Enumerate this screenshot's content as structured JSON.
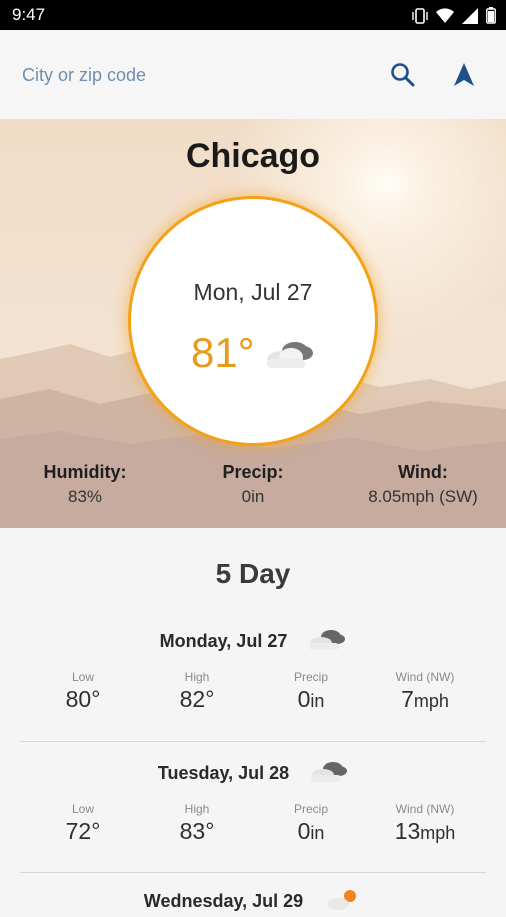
{
  "status_bar": {
    "time": "9:47"
  },
  "search": {
    "placeholder": "City or zip code"
  },
  "colors": {
    "accent": "#f4a11a",
    "temp": "#e89b19",
    "link": "#1f4e8c"
  },
  "current": {
    "city": "Chicago",
    "date": "Mon, Jul 27",
    "temp": "81°",
    "icon": "cloudy-icon",
    "stats": [
      {
        "label": "Humidity:",
        "value": "83%"
      },
      {
        "label": "Precip:",
        "value": "0in"
      },
      {
        "label": "Wind:",
        "value": "8.05mph (SW)"
      }
    ]
  },
  "forecast": {
    "title": "5 Day",
    "days": [
      {
        "name": "Monday, Jul 27",
        "icon": "cloudy-icon",
        "low_label": "Low",
        "low": "80°",
        "high_label": "High",
        "high": "82°",
        "precip_label": "Precip",
        "precip": "0",
        "precip_unit": "in",
        "wind_label": "Wind (NW)",
        "wind": "7",
        "wind_unit": "mph"
      },
      {
        "name": "Tuesday, Jul 28",
        "icon": "cloudy-icon",
        "low_label": "Low",
        "low": "72°",
        "high_label": "High",
        "high": "83°",
        "precip_label": "Precip",
        "precip": "0",
        "precip_unit": "in",
        "wind_label": "Wind (NW)",
        "wind": "13",
        "wind_unit": "mph"
      },
      {
        "name": "Wednesday, Jul 29",
        "icon": "partly-sunny-icon"
      }
    ]
  }
}
